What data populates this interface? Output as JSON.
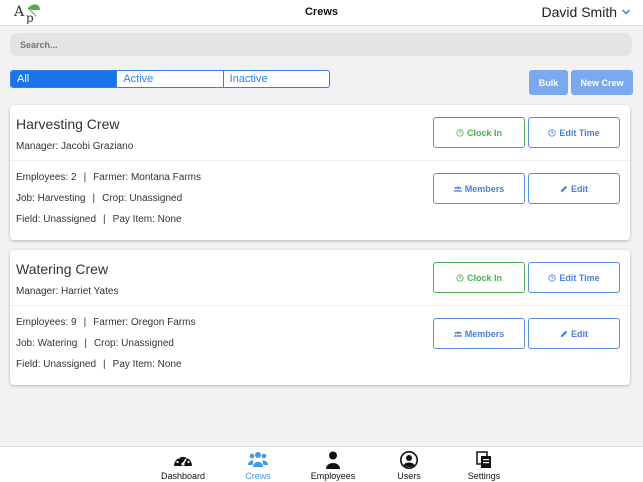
{
  "header": {
    "title": "Crews",
    "user_name": "David Smith"
  },
  "search": {
    "placeholder": "Search..."
  },
  "filters": {
    "all": "All",
    "active": "Active",
    "inactive": "Inactive"
  },
  "actions": {
    "bulk": "Bulk",
    "new_crew": "New Crew"
  },
  "crews": [
    {
      "name": "Harvesting Crew",
      "manager": "Manager: Jacobi Graziano",
      "employees": "Employees: 2",
      "farmer": "Farmer: Montana Farms",
      "job": "Job: Harvesting",
      "crop": "Crop: Unassigned",
      "field": "Field: Unassigned",
      "pay_item": "Pay Item: None"
    },
    {
      "name": "Watering Crew",
      "manager": "Manager: Harriet Yates",
      "employees": "Employees: 9",
      "farmer": "Farmer: Oregon Farms",
      "job": "Job: Watering",
      "crop": "Crop: Unassigned",
      "field": "Field: Unassigned",
      "pay_item": "Pay Item: None"
    }
  ],
  "card_buttons": {
    "clock_in": "Clock In",
    "edit_time": "Edit Time",
    "members": "Members",
    "edit": "Edit"
  },
  "separator": "|",
  "nav": {
    "dashboard": "Dashboard",
    "crews": "Crews",
    "employees": "Employees",
    "users": "Users",
    "settings": "Settings"
  },
  "colors": {
    "accent": "#1a73e8",
    "clock_in_green": "#4caf50",
    "nav_active": "#3f9be8"
  }
}
